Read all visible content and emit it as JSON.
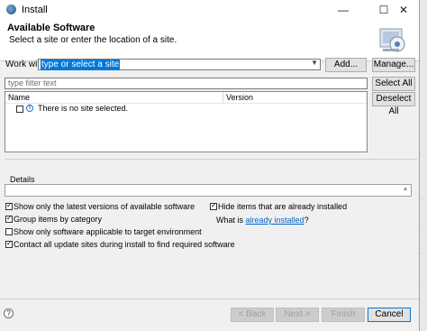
{
  "window": {
    "title": "Install"
  },
  "header": {
    "title": "Available Software",
    "description": "Select a site or enter the location of a site."
  },
  "work_with": {
    "label": "Work with:",
    "value": "type or select a site",
    "add_label": "Add...",
    "manage_label": "Manage..."
  },
  "filter": {
    "placeholder": "type filter text"
  },
  "table": {
    "columns": [
      "Name",
      "Version"
    ],
    "rows": [
      {
        "text": "There is no site selected."
      }
    ]
  },
  "select_all_label": "Select All",
  "deselect_all_label": "Deselect All",
  "details": {
    "label": "Details"
  },
  "options": {
    "latest_versions": {
      "label": "Show only the latest versions of available software",
      "checked": true
    },
    "group_by_category": {
      "label": "Group items by category",
      "checked": true
    },
    "applicable_only": {
      "label": "Show only software applicable to target environment",
      "checked": false
    },
    "contact_all_sites": {
      "label": "Contact all update sites during install to find required software",
      "checked": true
    },
    "hide_installed": {
      "label": "Hide items that are already installed",
      "checked": true
    },
    "what_is_prefix": "What is ",
    "already_installed_link": "already installed",
    "what_is_suffix": "?"
  },
  "footer": {
    "help_icon": "?",
    "back_label": "< Back",
    "next_label": "Next >",
    "finish_label": "Finish",
    "cancel_label": "Cancel"
  },
  "icons": {
    "minimize": "—",
    "maximize": "☐",
    "close": "✕",
    "dropdown": "▼",
    "info": "i"
  }
}
